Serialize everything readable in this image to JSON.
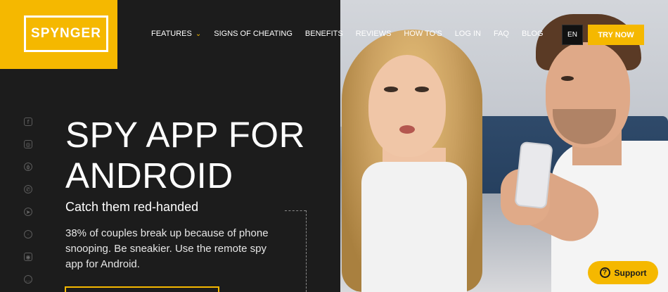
{
  "brand": {
    "logo_text": "SPYNGER",
    "accent": "#f5b800"
  },
  "nav": {
    "items": [
      {
        "label": "FEATURES",
        "dropdown": true
      },
      {
        "label": "SIGNS OF CHEATING"
      },
      {
        "label": "BENEFITS"
      },
      {
        "label": "REVIEWS"
      },
      {
        "label": "HOW TO'S"
      },
      {
        "label": "LOG IN"
      },
      {
        "label": "FAQ"
      },
      {
        "label": "BLOG"
      }
    ],
    "language": "EN",
    "cta": "TRY NOW"
  },
  "social": [
    "facebook-icon",
    "instagram-icon",
    "tinder-icon",
    "whatsapp-icon",
    "telegram-icon",
    "chat-icon",
    "camera-icon",
    "message-icon"
  ],
  "hero": {
    "title": "SPY APP FOR ANDROID",
    "subtitle": "Catch them red-handed",
    "description": "38% of couples break up because of phone snooping. Be sneakier. Use the remote spy app for Android."
  },
  "support": {
    "label": "Support",
    "icon": "?"
  }
}
